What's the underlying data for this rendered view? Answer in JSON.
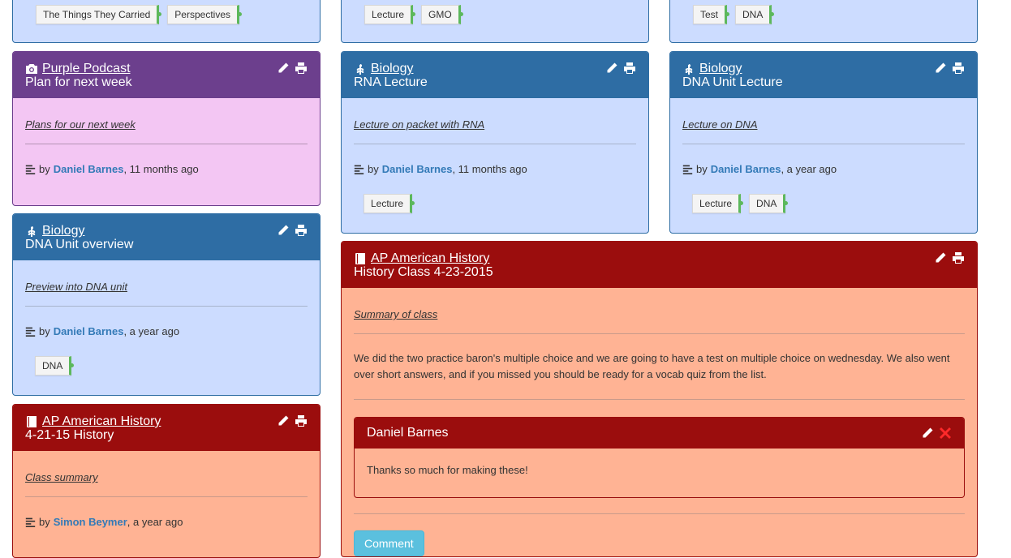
{
  "top_row": [
    {
      "tags": [
        "The Things They Carried",
        "Perspectives"
      ]
    },
    {
      "tags": [
        "Lecture",
        "GMO"
      ]
    },
    {
      "tags": [
        "Test",
        "DNA"
      ]
    }
  ],
  "cards": {
    "purple_podcast": {
      "subject": "Purple Podcast",
      "subject_icon": "camera-icon",
      "title": "Plan for next week",
      "summary": "Plans for our next week",
      "by": "by",
      "author": "Daniel Barnes",
      "time": ", 11 months ago"
    },
    "biology_rna": {
      "subject": "Biology",
      "subject_icon": "leaf-icon",
      "title": "RNA Lecture",
      "summary": "Lecture on packet with RNA",
      "by": "by",
      "author": "Daniel Barnes",
      "time": ", 11 months ago",
      "tags": [
        "Lecture"
      ]
    },
    "biology_dna_lecture": {
      "subject": "Biology",
      "subject_icon": "leaf-icon",
      "title": "DNA Unit Lecture",
      "summary": "Lecture on DNA",
      "by": "by",
      "author": "Daniel Barnes",
      "time": ", a year ago",
      "tags": [
        "Lecture",
        "DNA"
      ]
    },
    "biology_dna_overview": {
      "subject": "Biology",
      "subject_icon": "leaf-icon",
      "title": "DNA Unit overview",
      "summary": "Preview into DNA unit",
      "by": "by",
      "author": "Daniel Barnes",
      "time": ", a year ago",
      "tags": [
        "DNA"
      ]
    },
    "apush_class": {
      "subject": "AP American History",
      "subject_icon": "book-icon",
      "title": "History Class 4-23-2015",
      "summary": "Summary of class",
      "text": "We did the two practice baron's multiple choice and we are going to have a test on multiple choice on wednesday. We also went over short answers, and if you missed you should be ready for a vocab quiz from the list.",
      "comment": {
        "author": "Daniel Barnes",
        "text": "Thanks so much for making these!"
      },
      "comment_button": "Comment"
    },
    "apush_421": {
      "subject": "AP American History",
      "subject_icon": "book-icon",
      "title": "4-21-15 History",
      "summary": "Class summary",
      "by": "by",
      "author": "Simon Beymer",
      "time": ", a year ago"
    }
  },
  "colors": {
    "blue_header": "#2e6da4",
    "blue_body": "#ccdcff",
    "purple_header": "#6c3f8d",
    "purple_body": "#f3c6f3",
    "red_header": "#9b0d0d",
    "red_body": "#ffb394",
    "link": "#337ab7",
    "tag_accent": "#5cb85c"
  }
}
